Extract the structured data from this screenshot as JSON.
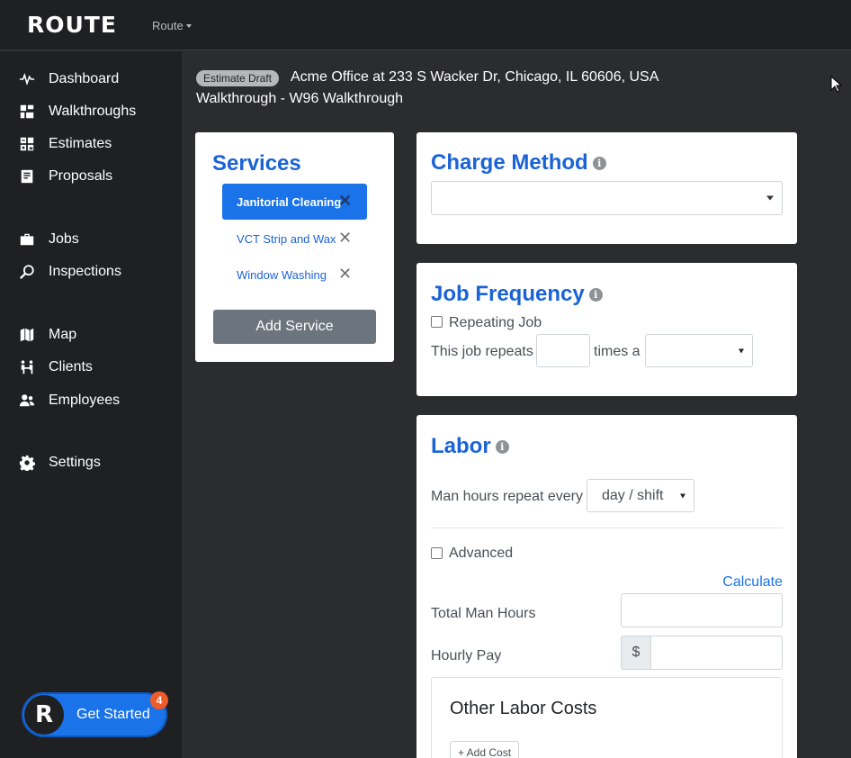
{
  "header": {
    "logo": "ROUTE",
    "menu_label": "Route"
  },
  "sidebar": {
    "items": [
      {
        "label": "Dashboard",
        "icon": "pulse-icon"
      },
      {
        "label": "Walkthroughs",
        "icon": "floorplan-icon"
      },
      {
        "label": "Estimates",
        "icon": "calculator-icon"
      },
      {
        "label": "Proposals",
        "icon": "document-icon"
      },
      {
        "label": "Jobs",
        "icon": "briefcase-icon"
      },
      {
        "label": "Inspections",
        "icon": "magnifier-icon"
      },
      {
        "label": "Map",
        "icon": "map-icon"
      },
      {
        "label": "Clients",
        "icon": "clients-icon"
      },
      {
        "label": "Employees",
        "icon": "people-icon"
      },
      {
        "label": "Settings",
        "icon": "gear-icon"
      }
    ],
    "get_started": {
      "label": "Get Started",
      "badge": "4",
      "logo": "R"
    }
  },
  "estimate": {
    "badge": "Estimate Draft",
    "address": "Acme Office at 233 S Wacker Dr, Chicago, IL 60606, USA",
    "walkthrough": "Walkthrough - W96 Walkthrough"
  },
  "services": {
    "title": "Services",
    "items": [
      {
        "name": "Janitorial Cleaning",
        "active": true
      },
      {
        "name": "VCT Strip and Wax",
        "active": false
      },
      {
        "name": "Window Washing",
        "active": false
      }
    ],
    "add_label": "Add Service"
  },
  "charge_method": {
    "title": "Charge Method",
    "selected": ""
  },
  "job_frequency": {
    "title": "Job Frequency",
    "repeating_label": "Repeating Job",
    "repeating_checked": false,
    "repeats_prefix": "This job repeats",
    "repeats_value": "",
    "repeats_middle": "times a",
    "period_selected": ""
  },
  "labor": {
    "title": "Labor",
    "man_hours_label": "Man hours repeat every",
    "man_hours_selected": "day / shift",
    "advanced_label": "Advanced",
    "advanced_checked": false,
    "calculate_label": "Calculate",
    "total_hours_label": "Total Man Hours",
    "total_hours_value": "",
    "hourly_pay_label": "Hourly Pay",
    "hourly_pay_prefix": "$",
    "hourly_pay_value": "",
    "other_costs_title": "Other Labor Costs",
    "add_cost_label": "+ Add Cost"
  }
}
